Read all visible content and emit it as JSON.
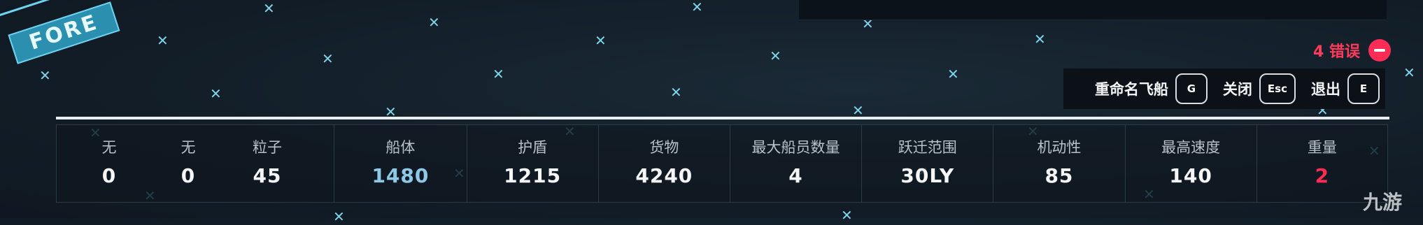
{
  "badge": {
    "text": "FORE"
  },
  "errors": {
    "count_text": "4 错误"
  },
  "actions": [
    {
      "label": "重命名飞船",
      "key": "G"
    },
    {
      "label": "关闭",
      "key": "Esc"
    },
    {
      "label": "退出",
      "key": "E"
    }
  ],
  "stats": {
    "slot1": {
      "label": "无",
      "value": "0"
    },
    "slot2": {
      "label": "无",
      "value": "0"
    },
    "particle": {
      "label": "粒子",
      "value": "45"
    },
    "hull": {
      "label": "船体",
      "value": "1480"
    },
    "shield": {
      "label": "护盾",
      "value": "1215"
    },
    "cargo": {
      "label": "货物",
      "value": "4240"
    },
    "crew": {
      "label": "最大船员数量",
      "value": "4"
    },
    "jump": {
      "label": "跃迁范围",
      "value": "30LY"
    },
    "mobility": {
      "label": "机动性",
      "value": "85"
    },
    "speed": {
      "label": "最高速度",
      "value": "140"
    },
    "mass": {
      "label": "重量",
      "value": "2"
    }
  },
  "watermark": {
    "text": "九游"
  },
  "colors": {
    "accent": "#6fd2ee",
    "error": "#ff2d55",
    "hull_value": "#8ec9e8"
  }
}
